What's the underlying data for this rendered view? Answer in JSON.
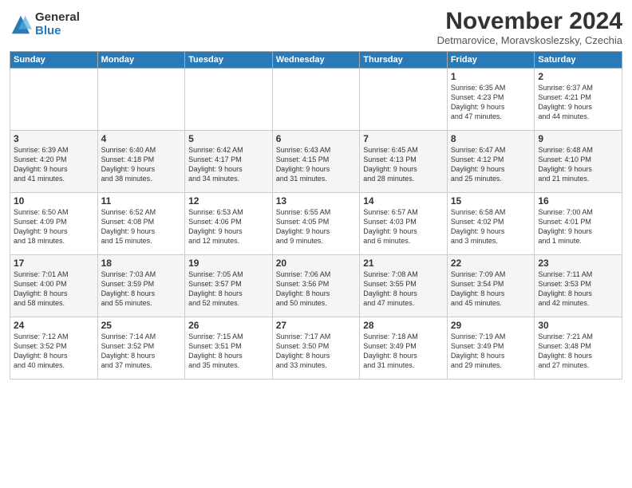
{
  "logo": {
    "general": "General",
    "blue": "Blue"
  },
  "title": "November 2024",
  "subtitle": "Detmarovice, Moravskoslezsky, Czechia",
  "headers": [
    "Sunday",
    "Monday",
    "Tuesday",
    "Wednesday",
    "Thursday",
    "Friday",
    "Saturday"
  ],
  "weeks": [
    [
      {
        "day": "",
        "info": ""
      },
      {
        "day": "",
        "info": ""
      },
      {
        "day": "",
        "info": ""
      },
      {
        "day": "",
        "info": ""
      },
      {
        "day": "",
        "info": ""
      },
      {
        "day": "1",
        "info": "Sunrise: 6:35 AM\nSunset: 4:23 PM\nDaylight: 9 hours\nand 47 minutes."
      },
      {
        "day": "2",
        "info": "Sunrise: 6:37 AM\nSunset: 4:21 PM\nDaylight: 9 hours\nand 44 minutes."
      }
    ],
    [
      {
        "day": "3",
        "info": "Sunrise: 6:39 AM\nSunset: 4:20 PM\nDaylight: 9 hours\nand 41 minutes."
      },
      {
        "day": "4",
        "info": "Sunrise: 6:40 AM\nSunset: 4:18 PM\nDaylight: 9 hours\nand 38 minutes."
      },
      {
        "day": "5",
        "info": "Sunrise: 6:42 AM\nSunset: 4:17 PM\nDaylight: 9 hours\nand 34 minutes."
      },
      {
        "day": "6",
        "info": "Sunrise: 6:43 AM\nSunset: 4:15 PM\nDaylight: 9 hours\nand 31 minutes."
      },
      {
        "day": "7",
        "info": "Sunrise: 6:45 AM\nSunset: 4:13 PM\nDaylight: 9 hours\nand 28 minutes."
      },
      {
        "day": "8",
        "info": "Sunrise: 6:47 AM\nSunset: 4:12 PM\nDaylight: 9 hours\nand 25 minutes."
      },
      {
        "day": "9",
        "info": "Sunrise: 6:48 AM\nSunset: 4:10 PM\nDaylight: 9 hours\nand 21 minutes."
      }
    ],
    [
      {
        "day": "10",
        "info": "Sunrise: 6:50 AM\nSunset: 4:09 PM\nDaylight: 9 hours\nand 18 minutes."
      },
      {
        "day": "11",
        "info": "Sunrise: 6:52 AM\nSunset: 4:08 PM\nDaylight: 9 hours\nand 15 minutes."
      },
      {
        "day": "12",
        "info": "Sunrise: 6:53 AM\nSunset: 4:06 PM\nDaylight: 9 hours\nand 12 minutes."
      },
      {
        "day": "13",
        "info": "Sunrise: 6:55 AM\nSunset: 4:05 PM\nDaylight: 9 hours\nand 9 minutes."
      },
      {
        "day": "14",
        "info": "Sunrise: 6:57 AM\nSunset: 4:03 PM\nDaylight: 9 hours\nand 6 minutes."
      },
      {
        "day": "15",
        "info": "Sunrise: 6:58 AM\nSunset: 4:02 PM\nDaylight: 9 hours\nand 3 minutes."
      },
      {
        "day": "16",
        "info": "Sunrise: 7:00 AM\nSunset: 4:01 PM\nDaylight: 9 hours\nand 1 minute."
      }
    ],
    [
      {
        "day": "17",
        "info": "Sunrise: 7:01 AM\nSunset: 4:00 PM\nDaylight: 8 hours\nand 58 minutes."
      },
      {
        "day": "18",
        "info": "Sunrise: 7:03 AM\nSunset: 3:59 PM\nDaylight: 8 hours\nand 55 minutes."
      },
      {
        "day": "19",
        "info": "Sunrise: 7:05 AM\nSunset: 3:57 PM\nDaylight: 8 hours\nand 52 minutes."
      },
      {
        "day": "20",
        "info": "Sunrise: 7:06 AM\nSunset: 3:56 PM\nDaylight: 8 hours\nand 50 minutes."
      },
      {
        "day": "21",
        "info": "Sunrise: 7:08 AM\nSunset: 3:55 PM\nDaylight: 8 hours\nand 47 minutes."
      },
      {
        "day": "22",
        "info": "Sunrise: 7:09 AM\nSunset: 3:54 PM\nDaylight: 8 hours\nand 45 minutes."
      },
      {
        "day": "23",
        "info": "Sunrise: 7:11 AM\nSunset: 3:53 PM\nDaylight: 8 hours\nand 42 minutes."
      }
    ],
    [
      {
        "day": "24",
        "info": "Sunrise: 7:12 AM\nSunset: 3:52 PM\nDaylight: 8 hours\nand 40 minutes."
      },
      {
        "day": "25",
        "info": "Sunrise: 7:14 AM\nSunset: 3:52 PM\nDaylight: 8 hours\nand 37 minutes."
      },
      {
        "day": "26",
        "info": "Sunrise: 7:15 AM\nSunset: 3:51 PM\nDaylight: 8 hours\nand 35 minutes."
      },
      {
        "day": "27",
        "info": "Sunrise: 7:17 AM\nSunset: 3:50 PM\nDaylight: 8 hours\nand 33 minutes."
      },
      {
        "day": "28",
        "info": "Sunrise: 7:18 AM\nSunset: 3:49 PM\nDaylight: 8 hours\nand 31 minutes."
      },
      {
        "day": "29",
        "info": "Sunrise: 7:19 AM\nSunset: 3:49 PM\nDaylight: 8 hours\nand 29 minutes."
      },
      {
        "day": "30",
        "info": "Sunrise: 7:21 AM\nSunset: 3:48 PM\nDaylight: 8 hours\nand 27 minutes."
      }
    ]
  ]
}
